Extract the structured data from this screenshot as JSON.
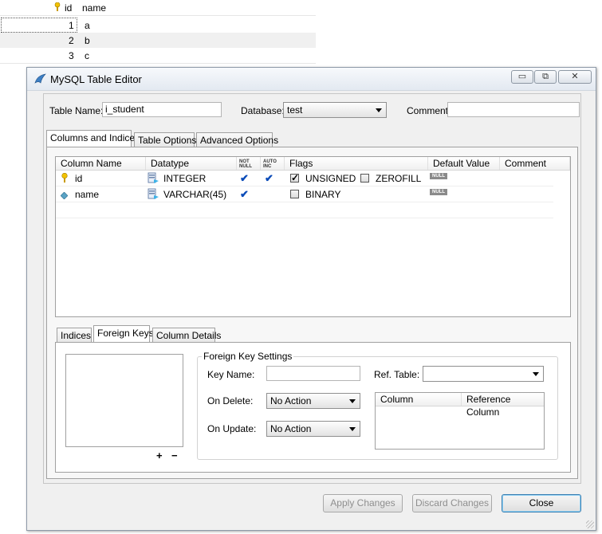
{
  "background_grid": {
    "headers": [
      "id",
      "name"
    ],
    "rows": [
      {
        "id": "1",
        "name": "a"
      },
      {
        "id": "2",
        "name": "b"
      },
      {
        "id": "3",
        "name": "c"
      }
    ]
  },
  "window": {
    "title": "MySQL Table Editor",
    "controls": {
      "minimize": "▭",
      "restore": "⧉",
      "close": "✕"
    }
  },
  "header_fields": {
    "table_name_label": "Table Name:",
    "table_name_value": "i_student",
    "database_label": "Database:",
    "database_value": "test",
    "comment_label": "Comment:",
    "comment_value": ""
  },
  "main_tabs": [
    "Columns and Indices",
    "Table Options",
    "Advanced Options"
  ],
  "columns_grid": {
    "headers": {
      "column_name": "Column Name",
      "datatype": "Datatype",
      "not_null_1": "NOT",
      "not_null_2": "NULL",
      "auto_inc_1": "AUTO",
      "auto_inc_2": "INC",
      "flags": "Flags",
      "default_value": "Default Value",
      "comment": "Comment"
    },
    "rows": [
      {
        "name": "id",
        "datatype": "INTEGER",
        "flag1": "UNSIGNED",
        "flag2": "ZEROFILL",
        "default": "NULL"
      },
      {
        "name": "name",
        "datatype": "VARCHAR(45)",
        "flag1": "BINARY",
        "default": "NULL"
      }
    ]
  },
  "sub_tabs": [
    "Indices",
    "Foreign Keys",
    "Column Details"
  ],
  "foreign_keys": {
    "add_label": "+",
    "remove_label": "−",
    "settings_title": "Foreign Key Settings",
    "key_name_label": "Key Name:",
    "key_name_value": "",
    "ref_table_label": "Ref. Table:",
    "ref_table_value": "",
    "on_delete_label": "On Delete:",
    "on_delete_value": "No Action",
    "on_update_label": "On Update:",
    "on_update_value": "No Action",
    "column_header": "Column",
    "reference_column_header": "Reference Column"
  },
  "footer": {
    "apply_label": "Apply Changes",
    "discard_label": "Discard Changes",
    "close_label": "Close"
  },
  "colors": {
    "accent": "#0a4bb8",
    "key_icon": "#f2c200"
  }
}
